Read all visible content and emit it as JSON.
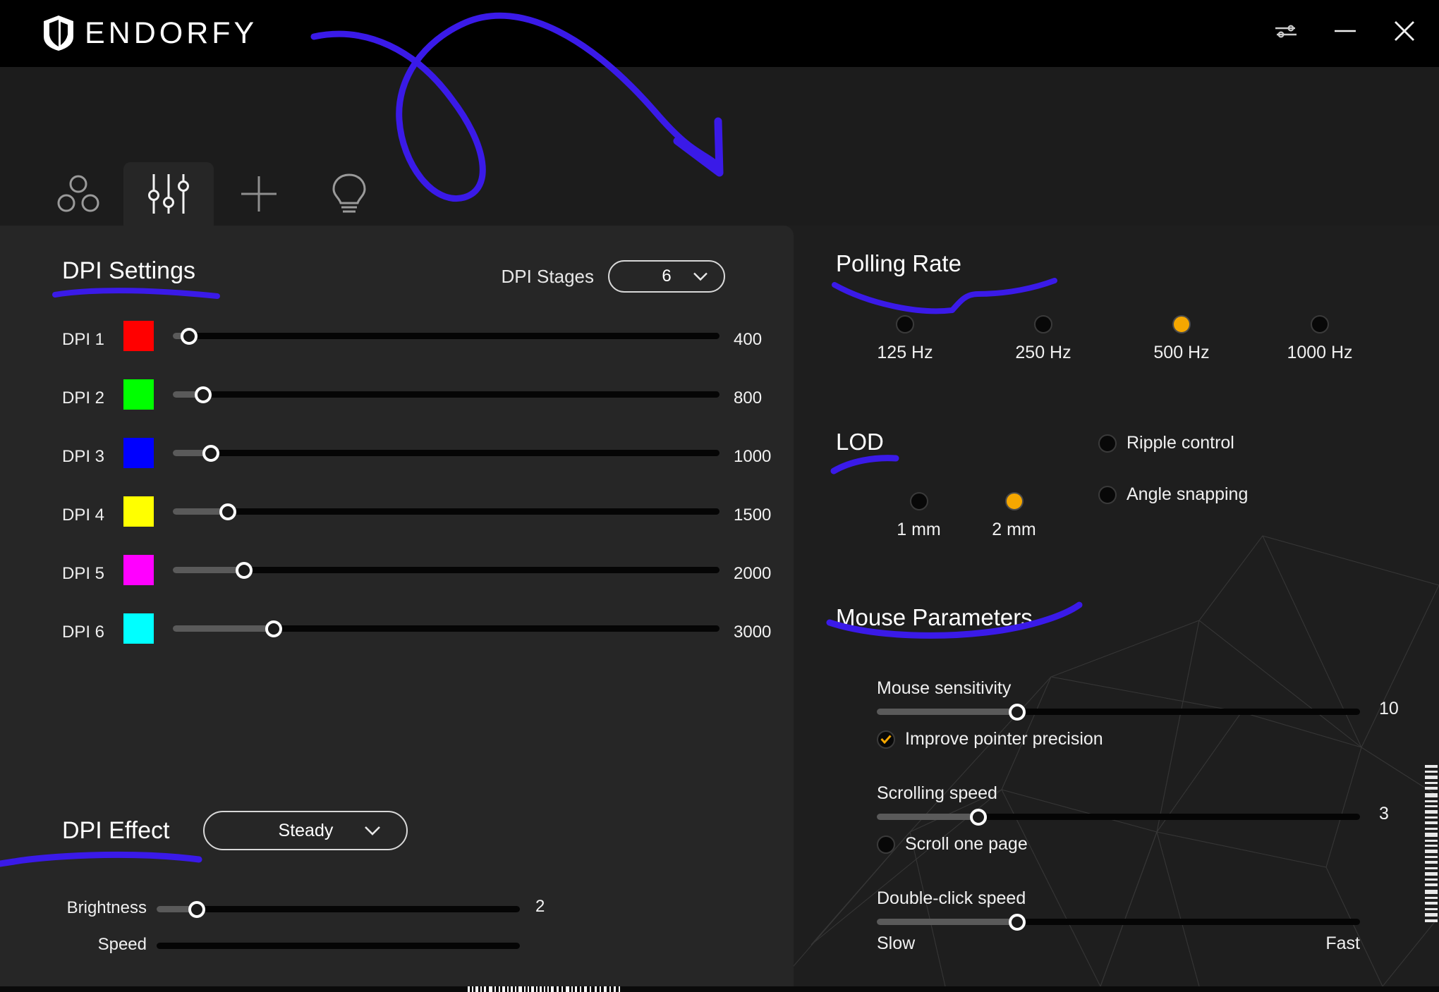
{
  "app": {
    "brand": "ENDORFY",
    "logo_icon": "endorfy-shield-icon"
  },
  "titlebar": {
    "settings_icon": "sliders-settings-icon",
    "minimize_icon": "minimize-icon",
    "close_icon": "close-icon"
  },
  "tabs": [
    {
      "name": "profiles",
      "icon": "three-circles-icon",
      "active": false
    },
    {
      "name": "performance",
      "icon": "sliders-icon",
      "active": true
    },
    {
      "name": "add",
      "icon": "plus-icon",
      "active": false
    },
    {
      "name": "lighting",
      "icon": "lightbulb-icon",
      "active": false
    }
  ],
  "dpi": {
    "title": "DPI Settings",
    "stages_label": "DPI Stages",
    "stages_value": "6",
    "stages_chevron_icon": "chevron-down-icon",
    "rows": [
      {
        "label": "DPI 1",
        "color": "#FF0000",
        "value": "400",
        "percent": 3
      },
      {
        "label": "DPI 2",
        "color": "#00FF00",
        "value": "800",
        "percent": 5.5
      },
      {
        "label": "DPI 3",
        "color": "#0000FF",
        "value": "1000",
        "percent": 7
      },
      {
        "label": "DPI 4",
        "color": "#FFFF00",
        "value": "1500",
        "percent": 10
      },
      {
        "label": "DPI 5",
        "color": "#FF00FF",
        "value": "2000",
        "percent": 13
      },
      {
        "label": "DPI 6",
        "color": "#00FFFF",
        "value": "3000",
        "percent": 18.5
      }
    ]
  },
  "dpi_effect": {
    "title": "DPI Effect",
    "mode_value": "Steady",
    "mode_chevron_icon": "chevron-down-icon",
    "brightness_label": "Brightness",
    "brightness_value": "2",
    "brightness_percent": 11,
    "speed_label": "Speed",
    "speed_percent": 0
  },
  "polling_rate": {
    "title": "Polling Rate",
    "options": [
      {
        "label": "125 Hz",
        "selected": false
      },
      {
        "label": "250 Hz",
        "selected": false
      },
      {
        "label": "500 Hz",
        "selected": true
      },
      {
        "label": "1000 Hz",
        "selected": false
      }
    ]
  },
  "lod": {
    "title": "LOD",
    "options": [
      {
        "label": "1 mm",
        "selected": false
      },
      {
        "label": "2 mm",
        "selected": true
      }
    ],
    "toggles": [
      {
        "label": "Ripple control",
        "checked": false
      },
      {
        "label": "Angle snapping",
        "checked": false
      }
    ]
  },
  "mouse_parameters": {
    "title": "Mouse Parameters",
    "sensitivity": {
      "label": "Mouse sensitivity",
      "value": "10",
      "percent": 29,
      "checkbox": {
        "label": "Improve pointer precision",
        "checked": true
      }
    },
    "scrolling": {
      "label": "Scrolling speed",
      "value": "3",
      "percent": 21,
      "checkbox": {
        "label": "Scroll one page",
        "checked": false
      }
    },
    "double_click": {
      "label": "Double-click speed",
      "percent": 29,
      "min_label": "Slow",
      "max_label": "Fast"
    }
  },
  "annotations": {
    "accent_color": "#3a1ae8",
    "marks": [
      "arrow-loop-top",
      "underline-dpi-settings",
      "underline-dpi-effect",
      "underline-polling-rate",
      "underline-lod",
      "underline-mouse-parameters"
    ]
  },
  "decor": {
    "barcode_bottom": "barcode-decoration",
    "barcode_right": "barcode-decoration-vertical",
    "wireframe": "low-poly-wireframe-pattern"
  }
}
